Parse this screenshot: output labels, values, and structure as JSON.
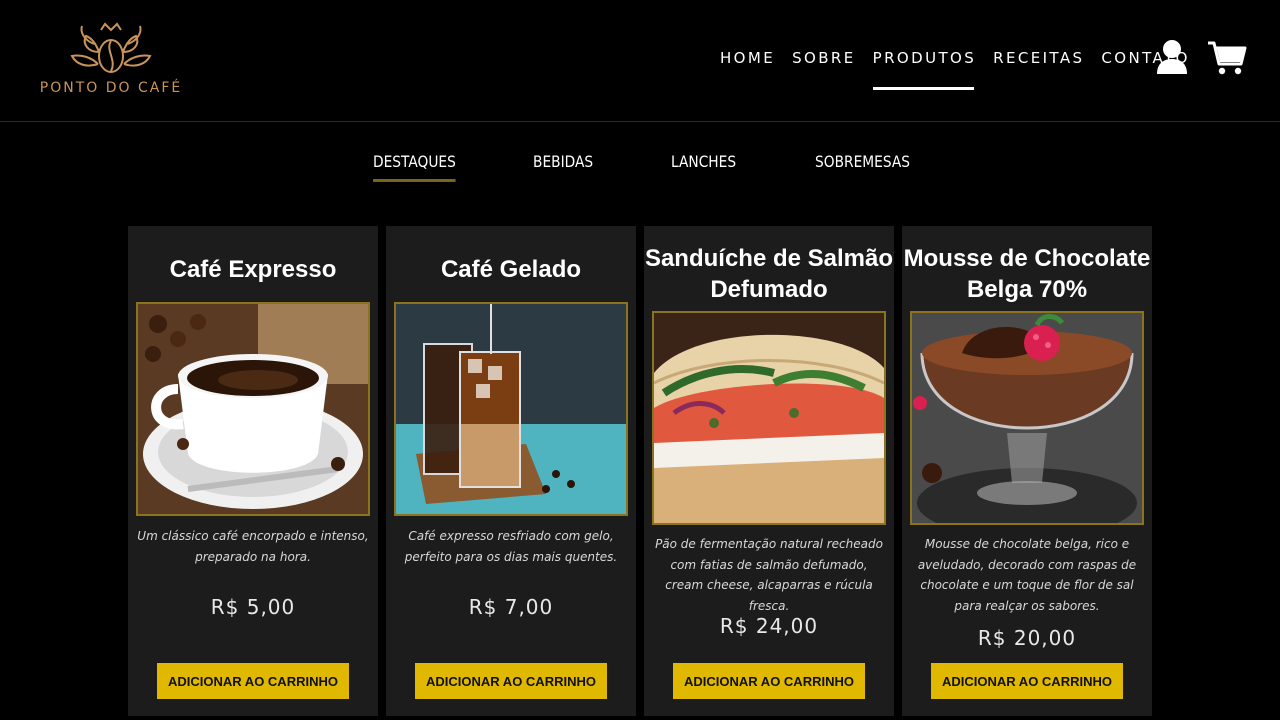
{
  "brand": {
    "name": "PONTO DO CAFÉ",
    "color": "#c9945a"
  },
  "nav": {
    "items": [
      {
        "label": "HOME"
      },
      {
        "label": "SOBRE"
      },
      {
        "label": "PRODUTOS",
        "active": true
      },
      {
        "label": "RECEITAS"
      },
      {
        "label": "CONTATO"
      }
    ],
    "icons": [
      "user-icon",
      "cart-icon"
    ]
  },
  "tabs": [
    {
      "label": "DESTAQUES",
      "active": true
    },
    {
      "label": "BEBIDAS"
    },
    {
      "label": "LANCHES"
    },
    {
      "label": "SOBREMESAS"
    }
  ],
  "products": [
    {
      "title": "Café Expresso",
      "description": "Um clássico café encorpado e intenso, preparado na hora.",
      "price": "R$ 5,00",
      "button": "ADICIONAR AO CARRINHO"
    },
    {
      "title": "Café Gelado",
      "description": "Café expresso resfriado com gelo, perfeito para os dias mais quentes.",
      "price": "R$ 7,00",
      "button": "ADICIONAR AO CARRINHO"
    },
    {
      "title": "Sanduíche de Salmão Defumado",
      "description": "Pão de fermentação natural recheado com fatias de salmão defumado, cream cheese, alcaparras e rúcula fresca.",
      "price": "R$ 24,00",
      "button": "ADICIONAR AO CARRINHO"
    },
    {
      "title": "Mousse de Chocolate Belga 70%",
      "description": "Mousse de chocolate belga, rico e aveludado, decorado com raspas de chocolate e um toque de flor de sal para realçar os sabores.",
      "price": "R$ 20,00",
      "button": "ADICIONAR AO CARRINHO"
    }
  ],
  "colors": {
    "accent": "#e0b800",
    "card_bg": "#1c1c1c",
    "image_border": "#8a7420"
  }
}
